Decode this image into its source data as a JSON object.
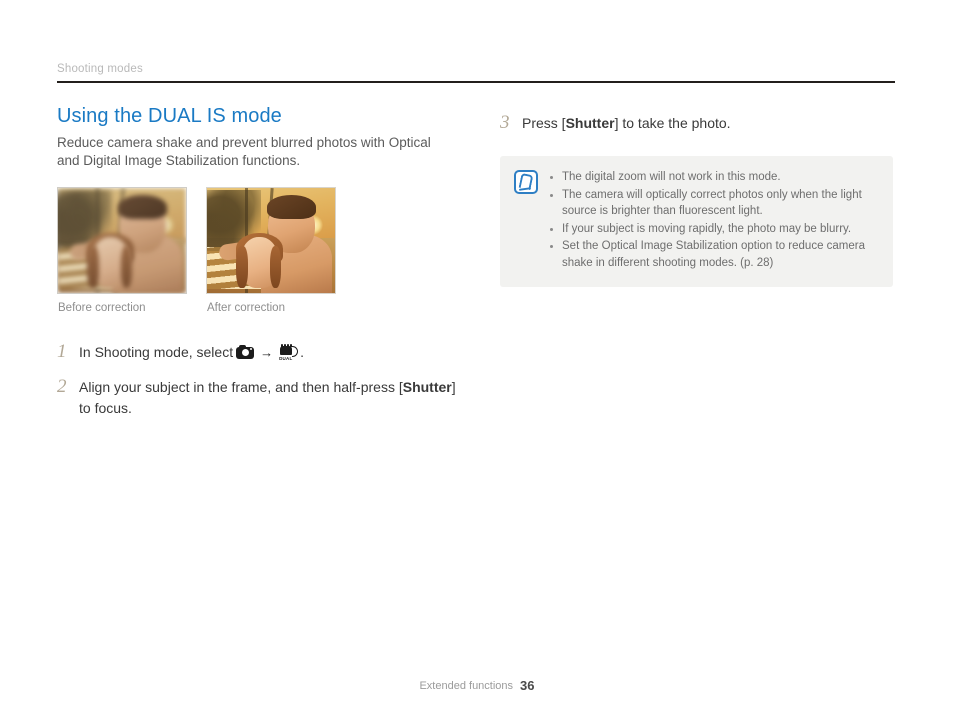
{
  "header": {
    "running_head": "Shooting modes"
  },
  "left_column": {
    "title": "Using the DUAL IS mode",
    "intro": "Reduce camera shake and prevent blurred photos with Optical and Digital Image Stabilization functions.",
    "figures": [
      {
        "caption": "Before correction",
        "state": "blurred"
      },
      {
        "caption": "After correction",
        "state": "sharp"
      }
    ],
    "steps": [
      {
        "number": "1",
        "text_before_icons": "In Shooting mode, select",
        "icon_1": "camera-mode-icon",
        "arrow": "→",
        "icon_2": "dual-is-icon",
        "dual_label": "DUAL",
        "text_after_icons": "."
      },
      {
        "number": "2",
        "text_part_1": "Align your subject in the frame, and then half-press [",
        "bold_term": "Shutter",
        "text_part_2": "] to focus."
      }
    ]
  },
  "right_column": {
    "step": {
      "number": "3",
      "text_part_1": "Press [",
      "bold_term": "Shutter",
      "text_part_2": "] to take the photo."
    },
    "note": {
      "icon": "note-pen-icon",
      "items": [
        "The digital zoom will not work in this mode.",
        "The camera will optically correct photos only when the light source is brighter than fluorescent light.",
        "If your subject is moving rapidly, the photo may be blurry.",
        "Set the Optical Image Stabilization option to reduce camera shake in different shooting modes. (p. 28)"
      ]
    }
  },
  "footer": {
    "section_label": "Extended functions",
    "page_number": "36"
  },
  "colors": {
    "title_blue": "#1a7ac4",
    "rule_black": "#231f1c",
    "running_head_gray": "#b9b9b9",
    "step_number_taupe": "#b2a896",
    "note_background": "#f2f2f0",
    "note_icon_blue": "#2e7fc4",
    "body_text": "#3a3a3a"
  }
}
